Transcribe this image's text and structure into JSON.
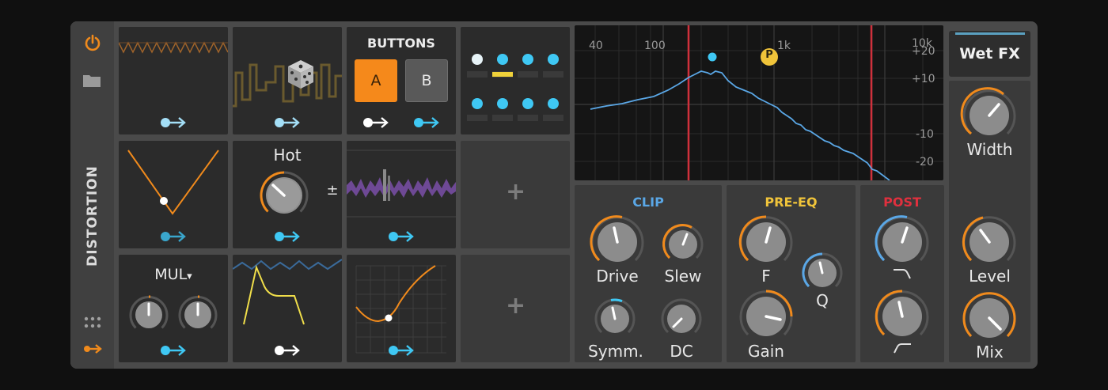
{
  "device": {
    "title": "DISTORTION",
    "icons": [
      "power-icon",
      "folder-icon",
      "grid-dots-icon",
      "modulation-arrow-icon"
    ],
    "accent": "#f08a1c"
  },
  "modulators": {
    "buttons": {
      "title": "BUTTONS",
      "a_label": "A",
      "b_label": "B"
    },
    "macro": {
      "label": "Hot",
      "sign": "±"
    },
    "math": {
      "mode": "MUL",
      "arrow": "▾"
    },
    "add_labels": [
      "+",
      "+"
    ]
  },
  "spectrum": {
    "freq_labels": [
      "40",
      "100",
      "1k",
      "10k"
    ],
    "db_labels": [
      "+20",
      "+10",
      "-10",
      "-20"
    ],
    "marker": "P"
  },
  "clip": {
    "title": "CLIP",
    "drive": "Drive",
    "slew": "Slew",
    "symm": "Symm.",
    "dc": "DC",
    "color": "#5aa7e6"
  },
  "pre_eq": {
    "title": "PRE-EQ",
    "f": "F",
    "q": "Q",
    "gain": "Gain",
    "color": "#f0c43a"
  },
  "post": {
    "title": "POST",
    "color": "#e0303e"
  },
  "wet": {
    "title": "Wet FX",
    "width": "Width",
    "level": "Level",
    "mix": "Mix"
  }
}
